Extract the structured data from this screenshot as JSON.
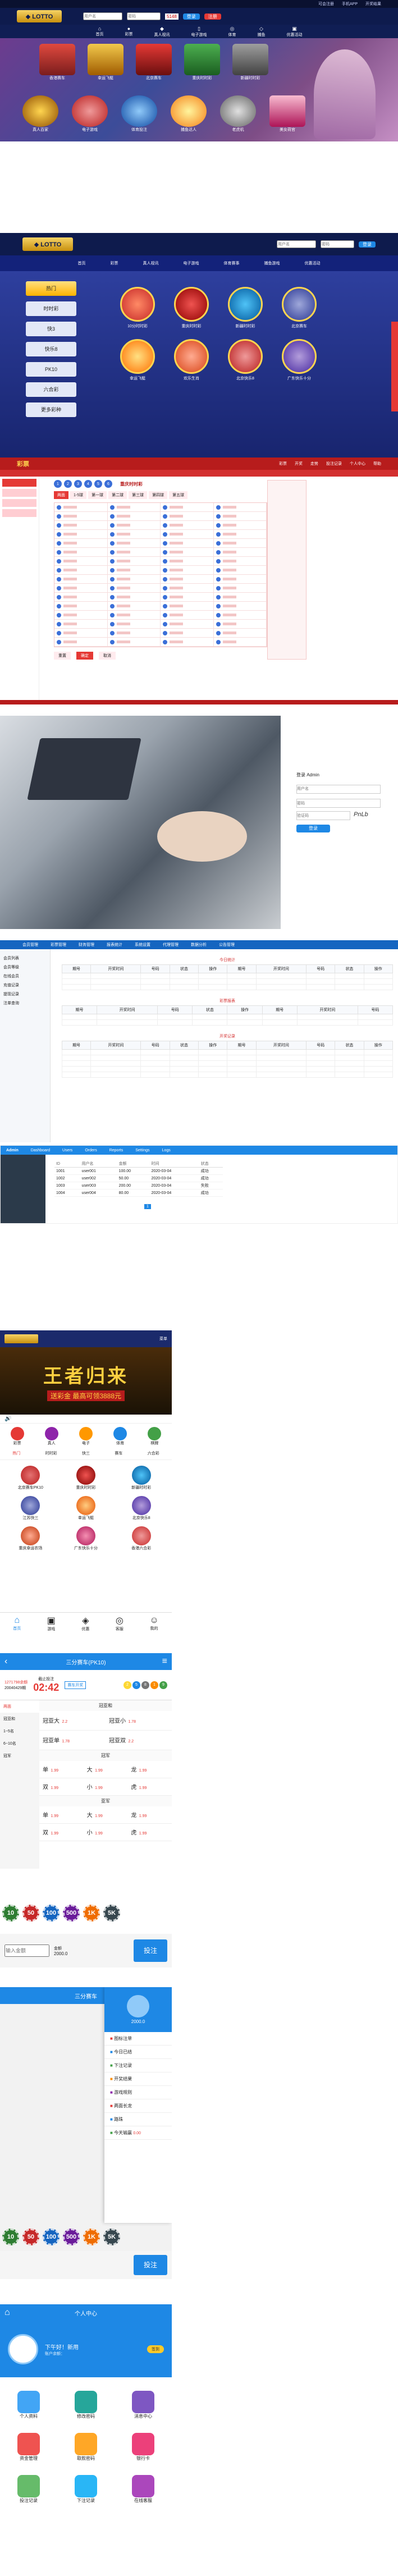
{
  "s1": {
    "top_links": [
      "可会注册",
      "手机APP",
      "开奖结果"
    ],
    "nav": [
      "首页",
      "彩票",
      "真人视讯",
      "电子游戏",
      "体育",
      "捕鱼",
      "优惠活动"
    ],
    "games": [
      "香港赛车",
      "幸运飞艇",
      "北京赛车",
      "重庆时时彩",
      "新疆时时彩",
      "欢乐生肖"
    ],
    "games2": [
      "真人百家",
      "电子游戏",
      "体育投注",
      "捕鱼达人",
      "老虎机",
      "美女荷官"
    ],
    "login_placeholder": "用户名",
    "pass_placeholder": "密码",
    "captcha": "5148",
    "login_btn": "登录",
    "reg_btn": "注册"
  },
  "s2": {
    "side": [
      "热门",
      "时时彩",
      "快3",
      "快乐8",
      "PK10",
      "六合彩",
      "更多彩种"
    ],
    "lotteries": [
      "10分时时彩",
      "重庆时时彩",
      "新疆时时彩",
      "北京赛车",
      "幸运飞艇",
      "欢乐生肖",
      "北京快乐8",
      "广东快乐十分"
    ],
    "nav": [
      "首页",
      "彩票",
      "真人视讯",
      "电子游戏",
      "体育赛事",
      "捕鱼游戏",
      "优惠活动"
    ]
  },
  "s3": {
    "logo": "彩票",
    "menu": [
      "彩票",
      "开奖",
      "走势",
      "投注记录",
      "个人中心",
      "帮助"
    ],
    "title": "重庆时时彩",
    "tabs": [
      "两面",
      "1-5球",
      "第一球",
      "第二球",
      "第三球",
      "第四球",
      "第五球"
    ],
    "footer": [
      "重置",
      "确定",
      "取消"
    ]
  },
  "s4": {
    "title": "登录 Admin",
    "user_ph": "用户名",
    "pass_ph": "密码",
    "code_ph": "验证码",
    "captcha": "PnLb",
    "btn": "登录"
  },
  "s5": {
    "tabs": [
      "会员管理",
      "彩票管理",
      "财务管理",
      "报表统计",
      "系统设置",
      "代理管理",
      "数据分析",
      "公告管理"
    ],
    "side": [
      "会员列表",
      "会员等级",
      "在线会员",
      "充值记录",
      "提现记录",
      "注单查询"
    ],
    "headers": [
      "期号",
      "开奖时间",
      "号码",
      "状态",
      "操作"
    ],
    "block_titles": [
      "今日统计",
      "彩票报表",
      "开奖记录"
    ]
  },
  "s6": {
    "logo": "Admin",
    "tabs": [
      "Dashboard",
      "Users",
      "Orders",
      "Reports",
      "Settings",
      "Logs"
    ],
    "headers": [
      "ID",
      "用户名",
      "金额",
      "时间",
      "状态"
    ],
    "rows": [
      [
        "1001",
        "user001",
        "100.00",
        "2020-03-04",
        "成功"
      ],
      [
        "1002",
        "user002",
        "50.00",
        "2020-03-04",
        "成功"
      ],
      [
        "1003",
        "user003",
        "200.00",
        "2020-03-04",
        "失败"
      ],
      [
        "1004",
        "user004",
        "80.00",
        "2020-03-04",
        "成功"
      ]
    ],
    "pager": "1"
  },
  "m1": {
    "header_link": "菜单",
    "banner_main": "王者归来",
    "banner_sub": "送彩金 最高可领3888元",
    "cats": [
      "彩票",
      "真人",
      "电子",
      "体育",
      "棋牌"
    ],
    "subcats": [
      "热门",
      "时时彩",
      "快三",
      "赛车",
      "六合彩"
    ],
    "games": [
      "北京赛车PK10",
      "重庆时时彩",
      "新疆时时彩",
      "江苏快三",
      "幸运飞艇",
      "北京快乐8",
      "重庆幸运农场",
      "广东快乐十分",
      "香港六合彩"
    ],
    "tabbar": [
      "首页",
      "游戏",
      "优惠",
      "客服",
      "我的"
    ]
  },
  "m2": {
    "title": "三分赛车(PK10)",
    "balance": "1271798余额",
    "issue": "20040429期",
    "issue_note": "截止投注",
    "countdown": "02:42",
    "results_label": "赛车开奖",
    "left_tabs": [
      "两面",
      "冠亚和",
      "1~5名",
      "6~10名",
      "冠军"
    ],
    "section_headers": [
      "冠亚和",
      "冠军",
      "亚军"
    ],
    "big_rows": [
      [
        "冠亚大",
        "2.2",
        "冠亚小",
        "1.78"
      ],
      [
        "冠亚单",
        "1.78",
        "冠亚双",
        "2.2"
      ]
    ],
    "ds_rows": [
      [
        "单",
        "1.99",
        "大",
        "1.99",
        "龙",
        "1.99"
      ],
      [
        "双",
        "1.99",
        "小",
        "1.99",
        "虎",
        "1.99"
      ]
    ],
    "chips": [
      "10",
      "50",
      "100",
      "500",
      "1K",
      "5K"
    ],
    "amount_ph": "输入金额",
    "bet_label": "金额",
    "bet_value": "2000.0",
    "submit": "投注"
  },
  "m3": {
    "title": "三分赛车",
    "user_amount": "2000.0",
    "menu": [
      "图标注单",
      "今日已结",
      "下注记录",
      "开奖结果",
      "游戏规则",
      "两面长龙",
      "路珠",
      "今天输赢"
    ],
    "menu_extra": "0.00",
    "chips": [
      "10",
      "50",
      "100",
      "500",
      "1K",
      "5K"
    ],
    "submit": "投注"
  },
  "m4": {
    "title": "个人中心",
    "hello": "下午好！新用",
    "account": "账户余额：",
    "signin": "签到",
    "grid": [
      "个人资料",
      "修改密码",
      "消息中心",
      "资金管理",
      "取款密码",
      "银行卡",
      "投注记录",
      "下注记录",
      "在线客服"
    ]
  }
}
